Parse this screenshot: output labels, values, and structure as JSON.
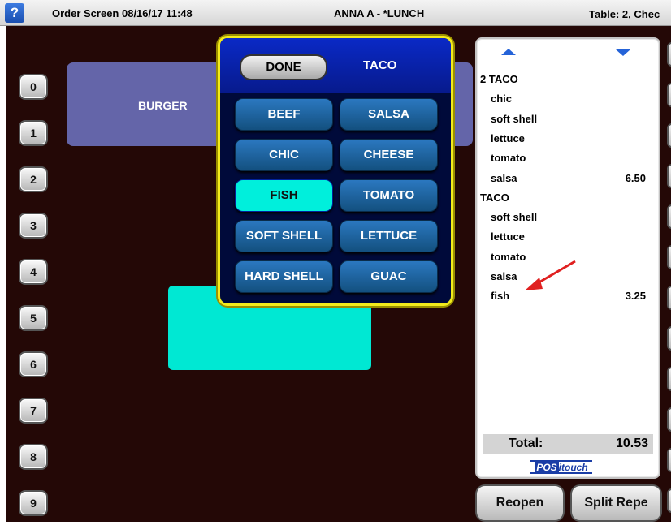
{
  "topbar": {
    "help_glyph": "?",
    "screen_title": "Order Screen 08/16/17 11:48",
    "user": "ANNA A - *LUNCH",
    "table": "Table:  2, Chec"
  },
  "keypad": [
    "0",
    "1",
    "2",
    "3",
    "4",
    "5",
    "6",
    "7",
    "8",
    "9"
  ],
  "menu_tiles": {
    "burger": "BURGER"
  },
  "modifier_popup": {
    "done_label": "DONE",
    "title": "TACO",
    "options": [
      {
        "label": "BEEF",
        "selected": false
      },
      {
        "label": "SALSA",
        "selected": false
      },
      {
        "label": "CHIC",
        "selected": false
      },
      {
        "label": "CHEESE",
        "selected": false
      },
      {
        "label": "FISH",
        "selected": true
      },
      {
        "label": "TOMATO",
        "selected": false
      },
      {
        "label": "SOFT SHELL",
        "selected": false
      },
      {
        "label": "LETTUCE",
        "selected": false
      },
      {
        "label": "HARD SHELL",
        "selected": false
      },
      {
        "label": "GUAC",
        "selected": false
      }
    ]
  },
  "check": {
    "scroll_up_icon": "triangle-up",
    "scroll_down_icon": "triangle-down",
    "lines": [
      {
        "text": "2 TACO",
        "indent": false,
        "price": ""
      },
      {
        "text": "chic",
        "indent": true,
        "price": ""
      },
      {
        "text": "soft shell",
        "indent": true,
        "price": ""
      },
      {
        "text": "lettuce",
        "indent": true,
        "price": ""
      },
      {
        "text": "tomato",
        "indent": true,
        "price": ""
      },
      {
        "text": "salsa",
        "indent": true,
        "price": "6.50"
      },
      {
        "text": "TACO",
        "indent": false,
        "price": ""
      },
      {
        "text": "soft shell",
        "indent": true,
        "price": ""
      },
      {
        "text": "lettuce",
        "indent": true,
        "price": ""
      },
      {
        "text": "tomato",
        "indent": true,
        "price": ""
      },
      {
        "text": "salsa",
        "indent": true,
        "price": ""
      },
      {
        "text": "fish",
        "indent": true,
        "price": "3.25"
      }
    ],
    "total_label": "Total:",
    "total_value": "10.53",
    "brand_pos": "POS",
    "brand_rest": "itouch"
  },
  "bottom_buttons": {
    "reopen": "Reopen",
    "split": "Split Repe"
  },
  "colors": {
    "background": "#240806",
    "popup_border": "#f3eb1c",
    "option_button": "#2b78c0",
    "option_selected": "#00efdc",
    "burger_tile": "#6465a9",
    "annotation_arrow": "#e02020"
  }
}
